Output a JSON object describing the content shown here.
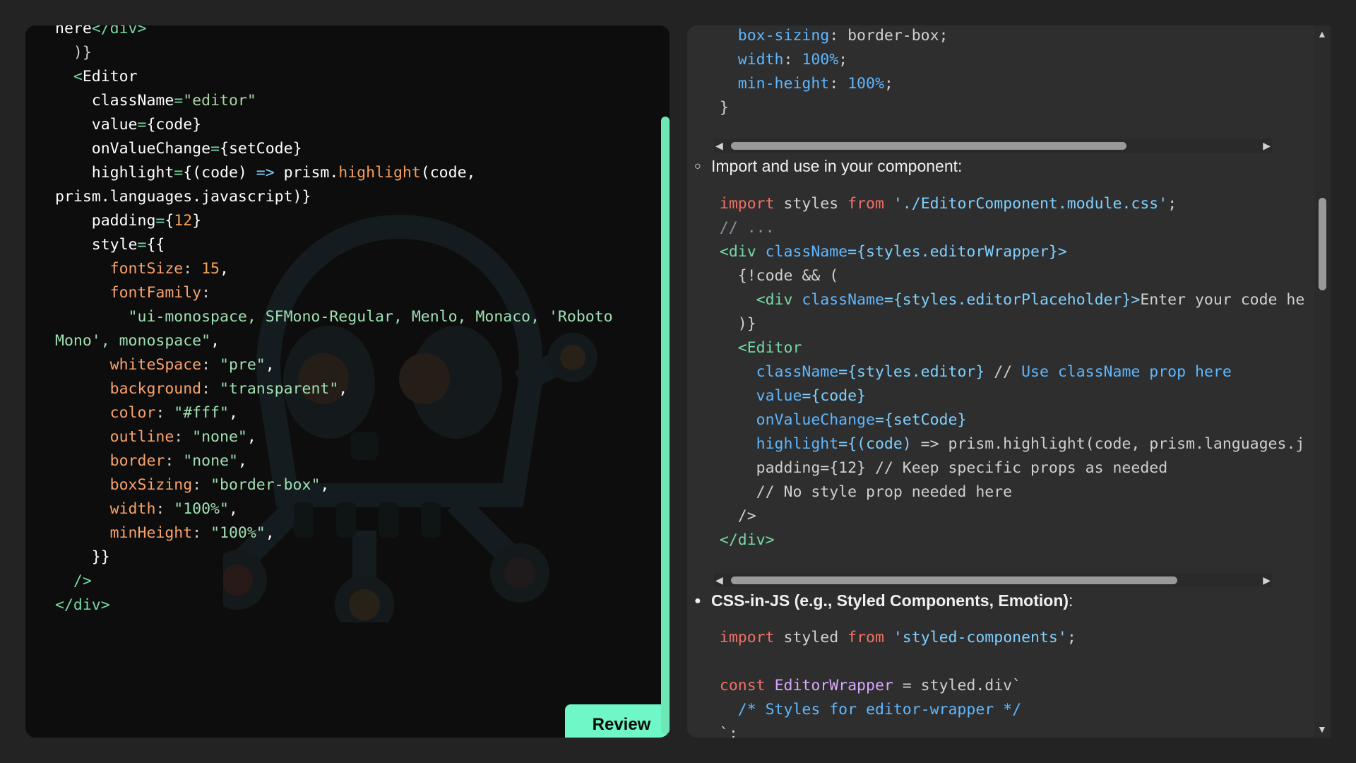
{
  "left_editor": {
    "lines": [
      [
        {
          "t": "here",
          "c": "w"
        },
        {
          "t": "</div>",
          "c": "t"
        }
      ],
      [
        {
          "t": "  )}",
          "c": "p"
        }
      ],
      [
        {
          "t": "  ",
          "c": "p"
        },
        {
          "t": "<",
          "c": "t"
        },
        {
          "t": "Editor",
          "c": "w"
        }
      ],
      [
        {
          "t": "    className",
          "c": "w"
        },
        {
          "t": "=",
          "c": "t"
        },
        {
          "t": "\"editor\"",
          "c": "s"
        }
      ],
      [
        {
          "t": "    value",
          "c": "w"
        },
        {
          "t": "=",
          "c": "t"
        },
        {
          "t": "{code}",
          "c": "w"
        }
      ],
      [
        {
          "t": "    onValueChange",
          "c": "w"
        },
        {
          "t": "=",
          "c": "t"
        },
        {
          "t": "{setCode}",
          "c": "w"
        }
      ],
      [
        {
          "t": "    highlight",
          "c": "w"
        },
        {
          "t": "=",
          "c": "t"
        },
        {
          "t": "{(code) ",
          "c": "w"
        },
        {
          "t": "=>",
          "c": "pr"
        },
        {
          "t": " prism.",
          "c": "w"
        },
        {
          "t": "highlight",
          "c": "fn"
        },
        {
          "t": "(code,",
          "c": "w"
        }
      ],
      [
        {
          "t": "prism.languages.javascript)}",
          "c": "w"
        }
      ],
      [
        {
          "t": "    padding",
          "c": "w"
        },
        {
          "t": "=",
          "c": "t"
        },
        {
          "t": "{",
          "c": "w"
        },
        {
          "t": "12",
          "c": "n"
        },
        {
          "t": "}",
          "c": "w"
        }
      ],
      [
        {
          "t": "    style",
          "c": "w"
        },
        {
          "t": "=",
          "c": "t"
        },
        {
          "t": "{{",
          "c": "w"
        }
      ],
      [
        {
          "t": "      fontSize",
          "c": "prop-l"
        },
        {
          "t": ": ",
          "c": "p"
        },
        {
          "t": "15",
          "c": "n"
        },
        {
          "t": ",",
          "c": "w"
        }
      ],
      [
        {
          "t": "      fontFamily",
          "c": "prop-l"
        },
        {
          "t": ":",
          "c": "p"
        }
      ],
      [
        {
          "t": "        \"ui-monospace, SFMono-Regular, Menlo, Monaco, 'Roboto",
          "c": "str-l"
        }
      ],
      [
        {
          "t": "Mono', monospace\"",
          "c": "str-l"
        },
        {
          "t": ",",
          "c": "w"
        }
      ],
      [
        {
          "t": "      whiteSpace",
          "c": "prop-l"
        },
        {
          "t": ": ",
          "c": "p"
        },
        {
          "t": "\"pre\"",
          "c": "str-l"
        },
        {
          "t": ",",
          "c": "w"
        }
      ],
      [
        {
          "t": "      background",
          "c": "prop-l"
        },
        {
          "t": ": ",
          "c": "p"
        },
        {
          "t": "\"transparent\"",
          "c": "str-l"
        },
        {
          "t": ",",
          "c": "w"
        }
      ],
      [
        {
          "t": "      color",
          "c": "prop-l"
        },
        {
          "t": ": ",
          "c": "p"
        },
        {
          "t": "\"#fff\"",
          "c": "str-l"
        },
        {
          "t": ",",
          "c": "w"
        }
      ],
      [
        {
          "t": "      outline",
          "c": "prop-l"
        },
        {
          "t": ": ",
          "c": "p"
        },
        {
          "t": "\"none\"",
          "c": "str-l"
        },
        {
          "t": ",",
          "c": "w"
        }
      ],
      [
        {
          "t": "      border",
          "c": "prop-l"
        },
        {
          "t": ": ",
          "c": "p"
        },
        {
          "t": "\"none\"",
          "c": "str-l"
        },
        {
          "t": ",",
          "c": "w"
        }
      ],
      [
        {
          "t": "      boxSizing",
          "c": "prop-l"
        },
        {
          "t": ": ",
          "c": "p"
        },
        {
          "t": "\"border-box\"",
          "c": "str-l"
        },
        {
          "t": ",",
          "c": "w"
        }
      ],
      [
        {
          "t": "      width",
          "c": "prop-l"
        },
        {
          "t": ": ",
          "c": "p"
        },
        {
          "t": "\"100%\"",
          "c": "str-l"
        },
        {
          "t": ",",
          "c": "w"
        }
      ],
      [
        {
          "t": "      minHeight",
          "c": "prop-l"
        },
        {
          "t": ": ",
          "c": "p"
        },
        {
          "t": "\"100%\"",
          "c": "str-l"
        },
        {
          "t": ",",
          "c": "w"
        }
      ],
      [
        {
          "t": "    }}",
          "c": "w"
        }
      ],
      [
        {
          "t": "  />",
          "c": "t"
        }
      ],
      [
        {
          "t": "</div>",
          "c": "t"
        }
      ]
    ]
  },
  "review_button": {
    "label": "Review"
  },
  "right_chat": {
    "css_block": [
      [
        {
          "t": "    box-sizing",
          "c": "blue"
        },
        {
          "t": ": border-box;",
          "c": "p"
        }
      ],
      [
        {
          "t": "    width",
          "c": "blue"
        },
        {
          "t": ": ",
          "c": "p"
        },
        {
          "t": "100%",
          "c": "blue"
        },
        {
          "t": ";",
          "c": "p"
        }
      ],
      [
        {
          "t": "    min-height",
          "c": "blue"
        },
        {
          "t": ": ",
          "c": "p"
        },
        {
          "t": "100%",
          "c": "blue"
        },
        {
          "t": ";",
          "c": "p"
        }
      ],
      [
        {
          "t": "  }",
          "c": "p"
        }
      ]
    ],
    "bullet_1": "Import and use in your component:",
    "jsx_block": [
      [
        {
          "t": "  import",
          "c": "k"
        },
        {
          "t": " styles ",
          "c": "p"
        },
        {
          "t": "from",
          "c": "k"
        },
        {
          "t": " ",
          "c": "p"
        },
        {
          "t": "'./EditorComponent.module.css'",
          "c": "pr"
        },
        {
          "t": ";",
          "c": "p"
        }
      ],
      [
        {
          "t": "  // ...",
          "c": "cm"
        }
      ],
      [
        {
          "t": "  <div ",
          "c": "t"
        },
        {
          "t": "className",
          "c": "blue"
        },
        {
          "t": "={styles.editorWrapper}>",
          "c": "pr"
        }
      ],
      [
        {
          "t": "    {!code && (",
          "c": "p"
        }
      ],
      [
        {
          "t": "      <div ",
          "c": "t"
        },
        {
          "t": "className",
          "c": "blue"
        },
        {
          "t": "={styles.editorPlaceholder}>",
          "c": "pr"
        },
        {
          "t": "Enter your code he",
          "c": "p"
        }
      ],
      [
        {
          "t": "    )}",
          "c": "p"
        }
      ],
      [
        {
          "t": "    <Editor",
          "c": "t"
        }
      ],
      [
        {
          "t": "      className",
          "c": "blue"
        },
        {
          "t": "={styles.editor}",
          "c": "pr"
        },
        {
          "t": " // ",
          "c": "p"
        },
        {
          "t": "Use className prop here",
          "c": "blue"
        }
      ],
      [
        {
          "t": "      value",
          "c": "blue"
        },
        {
          "t": "={code}",
          "c": "pr"
        }
      ],
      [
        {
          "t": "      onValueChange",
          "c": "blue"
        },
        {
          "t": "={setCode}",
          "c": "pr"
        }
      ],
      [
        {
          "t": "      highlight",
          "c": "blue"
        },
        {
          "t": "={(code)",
          "c": "pr"
        },
        {
          "t": " => prism.highlight(code, prism.languages.j",
          "c": "p"
        }
      ],
      [
        {
          "t": "      padding={12} // Keep specific props as needed",
          "c": "p"
        }
      ],
      [
        {
          "t": "      // No style prop needed here",
          "c": "p"
        }
      ],
      [
        {
          "t": "    />",
          "c": "p"
        }
      ],
      [
        {
          "t": "  </div>",
          "c": "t"
        }
      ]
    ],
    "bullet_2": "CSS-in-JS (e.g., Styled Components, Emotion)",
    "bullet_2_suffix": ":",
    "styled_block": [
      [
        {
          "t": "  import",
          "c": "k"
        },
        {
          "t": " styled ",
          "c": "p"
        },
        {
          "t": "from",
          "c": "k"
        },
        {
          "t": " ",
          "c": "p"
        },
        {
          "t": "'styled-components'",
          "c": "pr"
        },
        {
          "t": ";",
          "c": "p"
        }
      ],
      [
        {
          "t": "",
          "c": "p"
        }
      ],
      [
        {
          "t": "  const",
          "c": "k"
        },
        {
          "t": " ",
          "c": "p"
        },
        {
          "t": "EditorWrapper",
          "c": "purp"
        },
        {
          "t": " = styled.div`",
          "c": "p"
        }
      ],
      [
        {
          "t": "    /* Styles for editor-wrapper */",
          "c": "blue"
        }
      ],
      [
        {
          "t": "  `;",
          "c": "p"
        }
      ]
    ]
  }
}
